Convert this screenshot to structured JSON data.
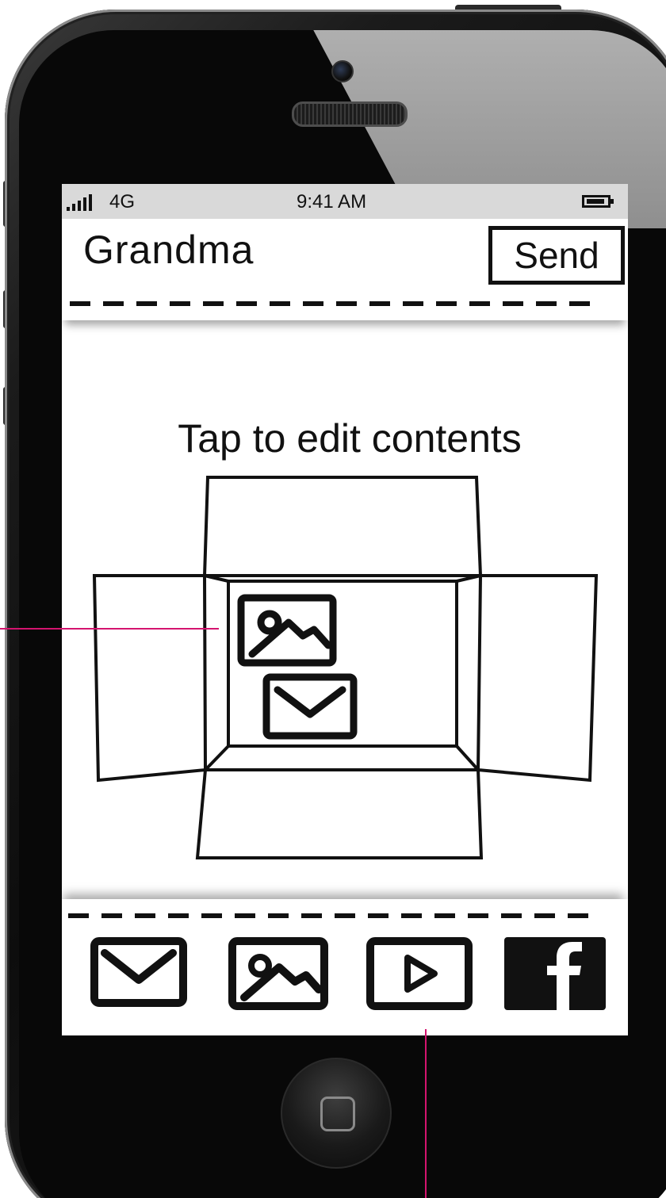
{
  "status_bar": {
    "network": "4G",
    "time": "9:41 AM"
  },
  "header": {
    "contact_name": "Grandma",
    "send_label": "Send"
  },
  "content": {
    "hint": "Tap to edit contents"
  },
  "box_contents": [
    "image-icon",
    "envelope-icon"
  ],
  "toolbar": {
    "items": [
      "mail-icon",
      "photo-icon",
      "video-icon",
      "facebook-icon"
    ]
  },
  "colors": {
    "annotation": "#d4146f",
    "status_bar_bg": "#d9d9d9",
    "ink": "#111111"
  }
}
